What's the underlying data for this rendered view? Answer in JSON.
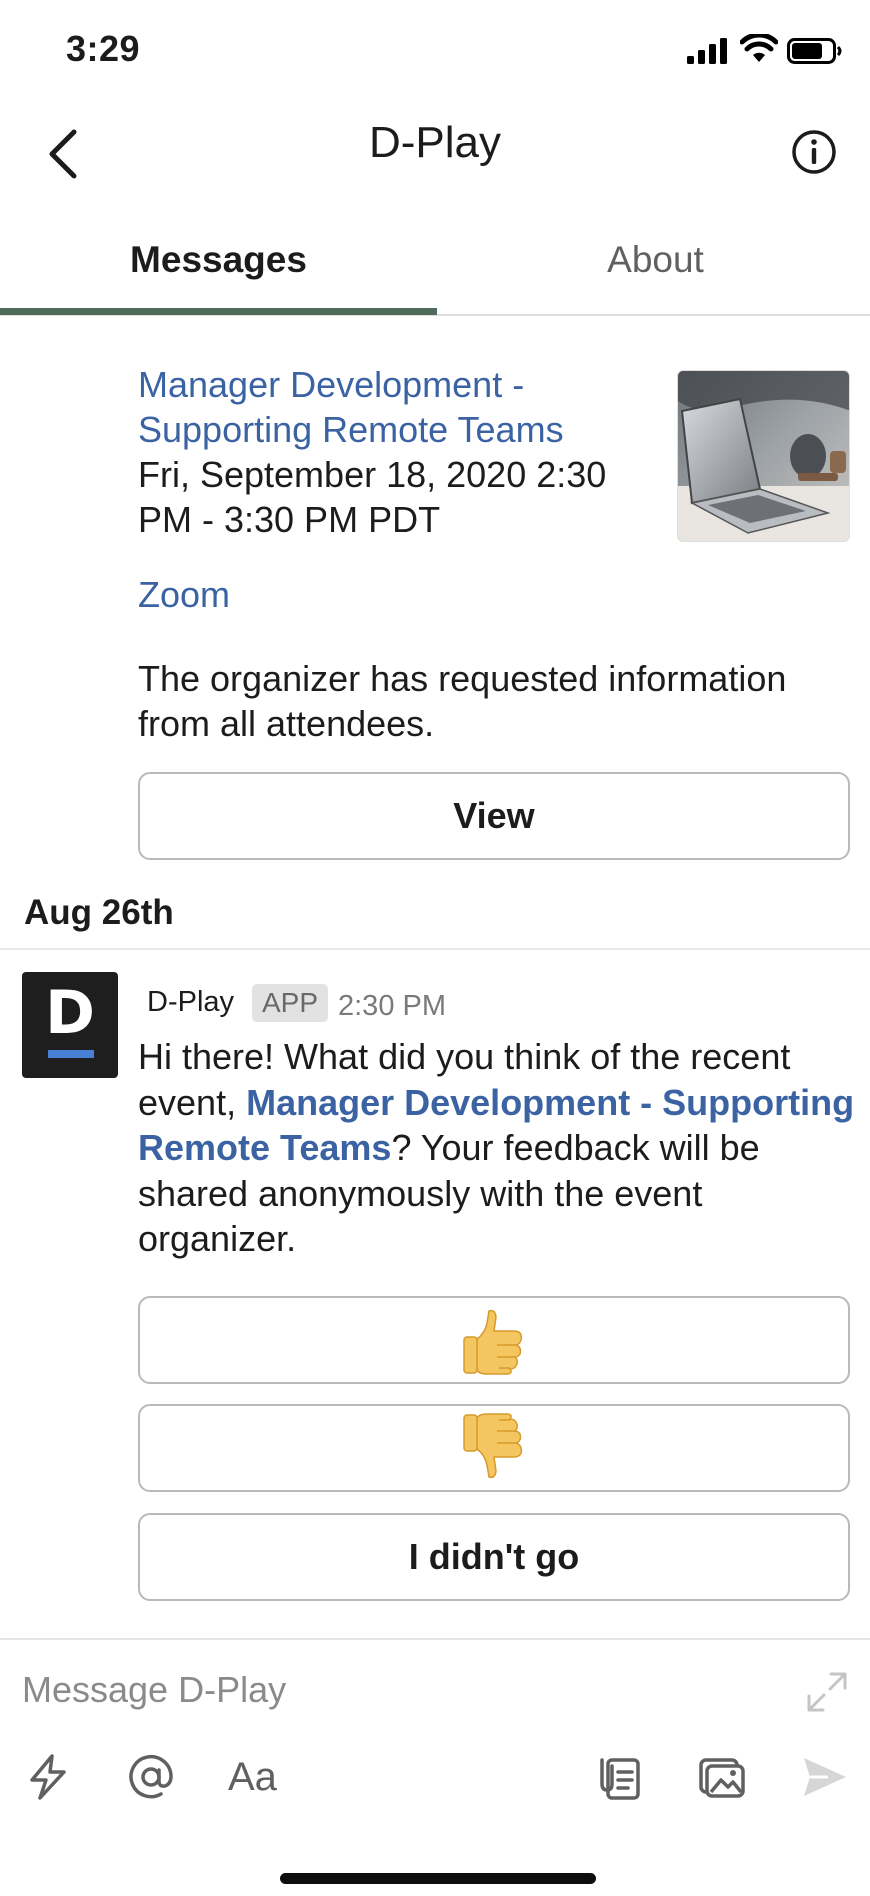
{
  "status_bar": {
    "time": "3:29"
  },
  "nav": {
    "title": "D-Play"
  },
  "tabs": [
    {
      "label": "Messages",
      "active": true
    },
    {
      "label": "About",
      "active": false
    }
  ],
  "event": {
    "title": "Manager Development - Supporting Remote Teams",
    "datetime": "Fri, September 18, 2020  2:30 PM -  3:30 PM PDT",
    "location": "Zoom",
    "note": "The organizer has requested information from all attendees.",
    "view_button": "View"
  },
  "date_divider": "Aug 26th",
  "message": {
    "sender": "D-Play",
    "badge": "APP",
    "time": "2:30 PM",
    "text_before": "Hi there! What did you think of the recent event, ",
    "link_text": "Manager Development - Supporting Remote Teams",
    "text_after": "? Your feedback will be shared anonymously with the event organizer.",
    "avatar_letter": "D",
    "buttons": {
      "thumbs_up_icon": "thumbs-up-icon",
      "thumbs_down_icon": "thumbs-down-icon",
      "didnt_go": "I didn't go"
    }
  },
  "composer": {
    "placeholder": "Message D-Play",
    "format_label": "Aa"
  },
  "colors": {
    "link": "#3b63a3",
    "tab_indicator": "#4e6b5c",
    "avatar_bg": "#1e1e1e",
    "avatar_accent": "#4a7fd6"
  }
}
